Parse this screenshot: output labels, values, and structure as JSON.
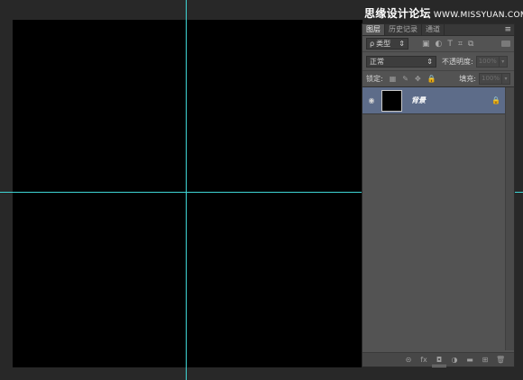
{
  "watermark": {
    "title": "思缘设计论坛",
    "site": "WWW.MISSYUAN.COM"
  },
  "tabs": [
    {
      "label": "图层",
      "active": true
    },
    {
      "label": "历史记录",
      "active": false
    },
    {
      "label": "通道",
      "active": false
    }
  ],
  "panel_menu_icon": "≡",
  "filter": {
    "search_icon": "ρ",
    "label": "类型",
    "arrow": "⇕",
    "icons": [
      "▣",
      "◐",
      "T",
      "⌗",
      "⧉"
    ]
  },
  "blend": {
    "mode": "正常",
    "arrow": "⇕",
    "opacity_label": "不透明度:",
    "opacity_value": "100%",
    "dropdown_arrow": "▾"
  },
  "lock": {
    "label": "锁定:",
    "icons": [
      "▦",
      "✎",
      "✥",
      "🔒"
    ],
    "fill_label": "填充:",
    "fill_value": "100%",
    "dropdown_arrow": "▾"
  },
  "layers": [
    {
      "name": "背景",
      "visible_icon": "◉",
      "locked_icon": "🔒"
    }
  ],
  "bottom_icons": [
    "⊝",
    "fx",
    "◘",
    "◑",
    "▬",
    "⊞",
    "🗑"
  ],
  "colors": {
    "guide": "#3fd6d6",
    "selected_layer": "#5d6c89",
    "canvas": "#000000"
  }
}
